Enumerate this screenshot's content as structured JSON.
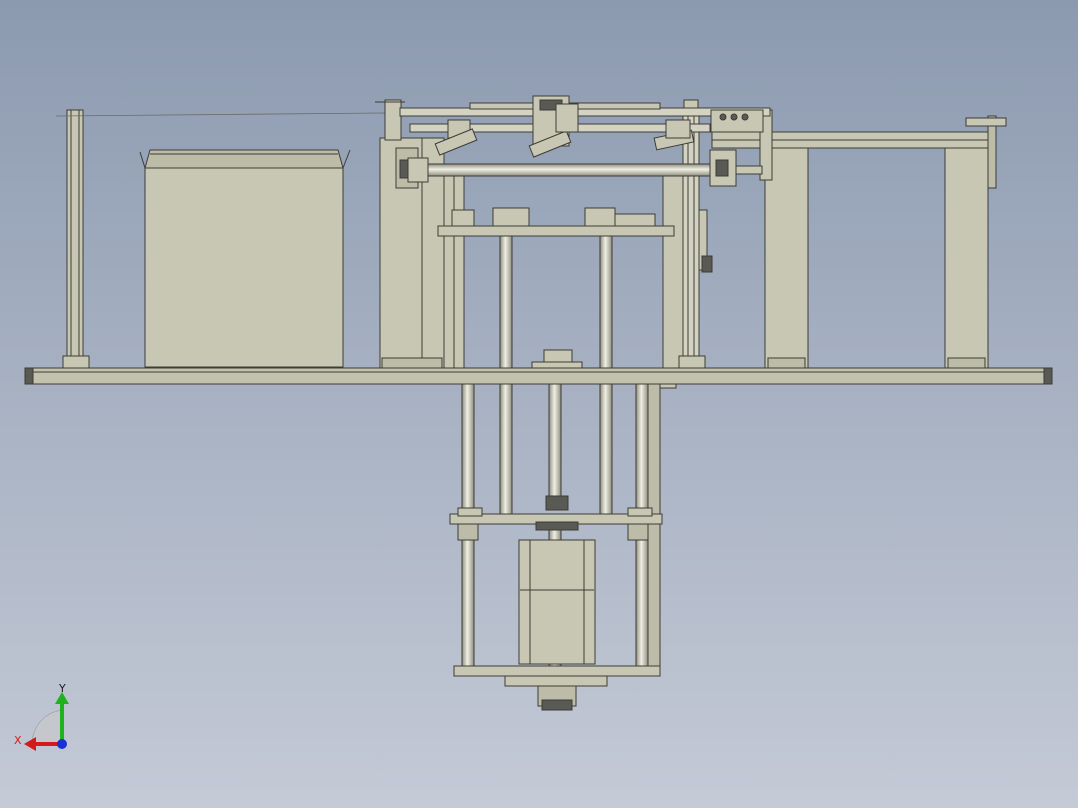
{
  "viewport": {
    "background_top": "#8c9ab0",
    "background_bottom": "#c4cad6"
  },
  "model": {
    "part_fill": "#c8c7b4",
    "part_stroke": "#3c3c36",
    "shadow_fill": "#9c9b8c",
    "dark_fill": "#5a5a55"
  },
  "triad": {
    "x_label": "X",
    "y_label": "Y",
    "x_color": "#d41a1a",
    "y_color": "#1fb21f",
    "z_color": "#1a2fd4",
    "icons": [
      "coordinate-triad-icon"
    ]
  }
}
